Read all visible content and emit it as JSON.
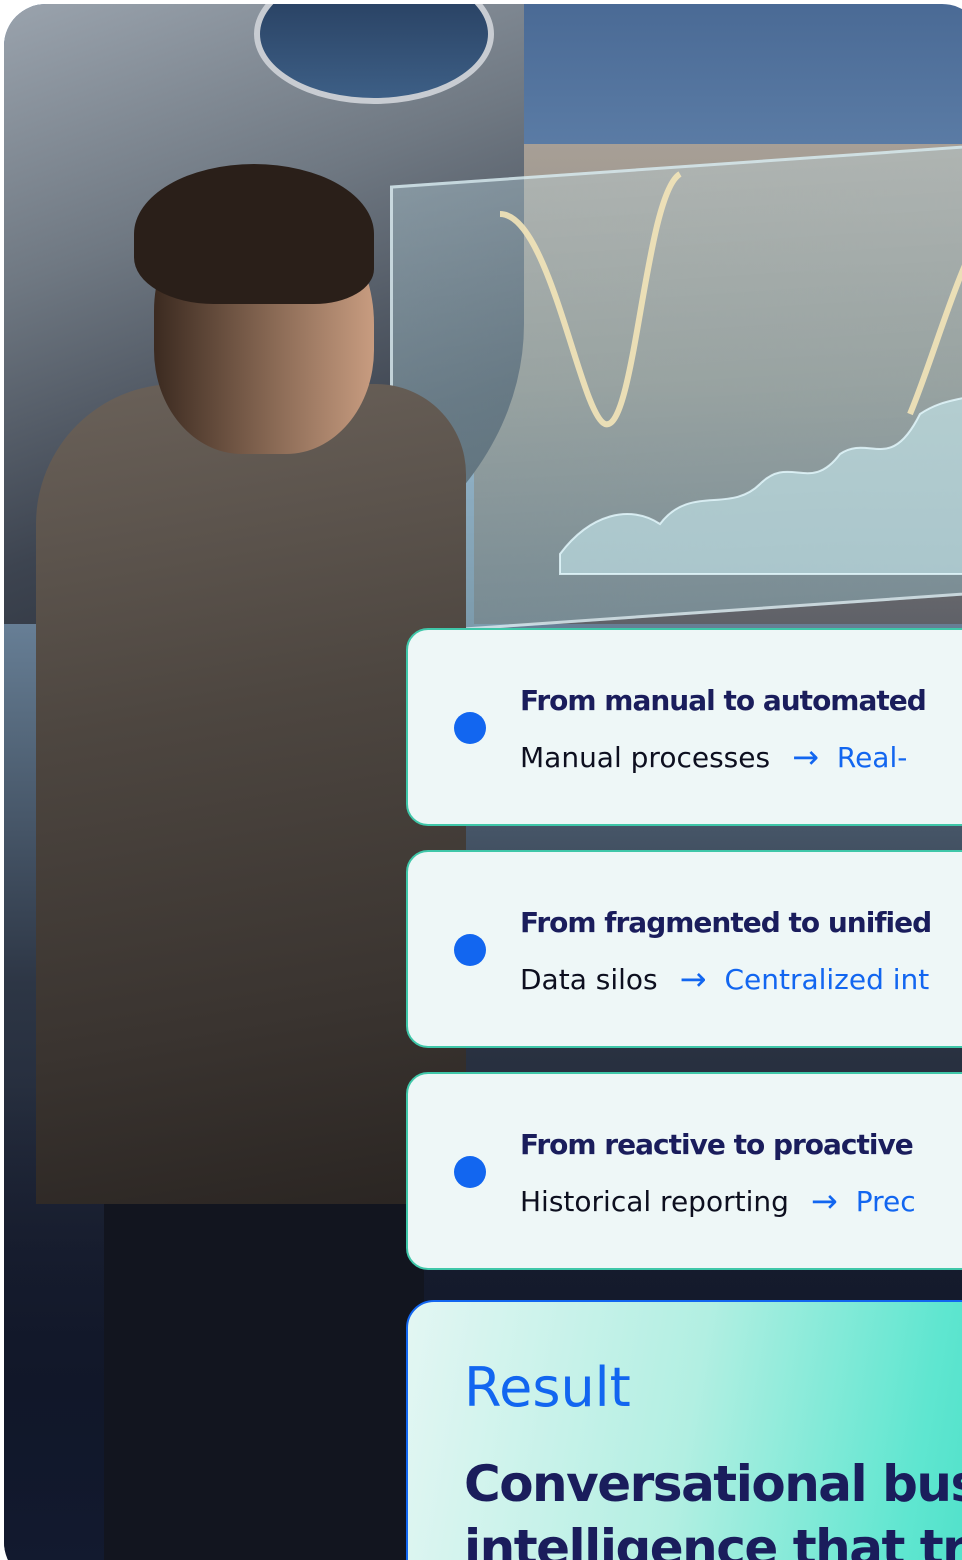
{
  "transformations": [
    {
      "title": "From manual to automated",
      "from": "Manual processes",
      "to": "Real-"
    },
    {
      "title": "From fragmented to unified",
      "from": "Data silos",
      "to": "Centralized int"
    },
    {
      "title": "From reactive to proactive",
      "from": "Historical reporting",
      "to": "Prec"
    }
  ],
  "result": {
    "label": "Result",
    "line1": "Conversational bus",
    "line2": "intelligence that tra"
  },
  "colors": {
    "accent": "#1266f0",
    "title": "#1a1d5c",
    "card_border": "#3fc7a9",
    "card_bg": "#eef7f7"
  },
  "icons": {
    "bullet": "dot-icon",
    "arrow": "arrow-right-icon"
  }
}
